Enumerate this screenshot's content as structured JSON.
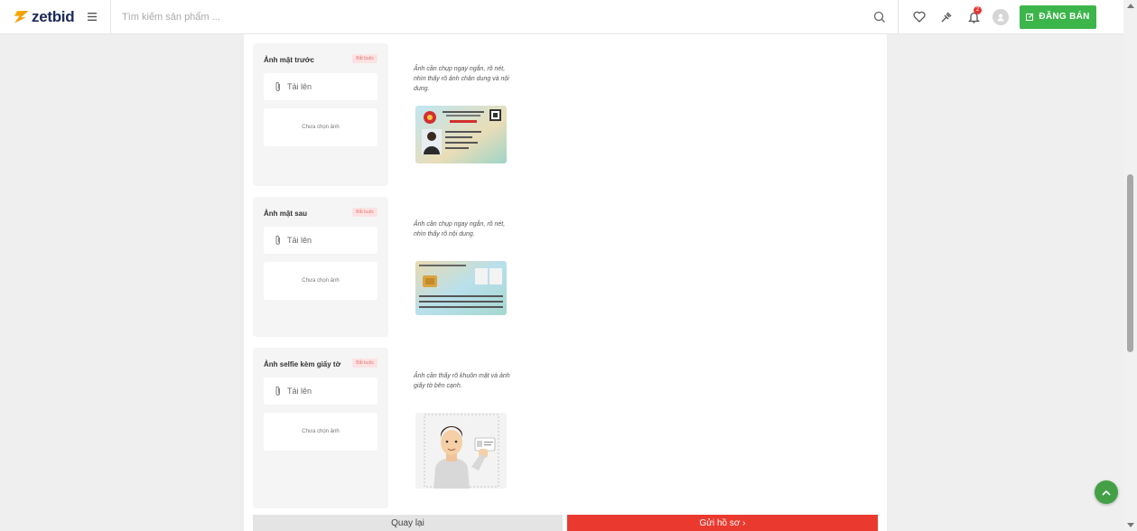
{
  "header": {
    "logo_text": "zetbid",
    "search_placeholder": "Tìm kiếm sản phẩm ...",
    "notification_count": "2",
    "sell_button_label": "ĐĂNG BÁN"
  },
  "cards": [
    {
      "title": "Ảnh mặt trước",
      "badge": "Bắt buộc",
      "upload_label": "Tải lên",
      "preview_text": "Chưa chọn ảnh",
      "hint": "Ảnh cần chụp ngay ngắn, rõ nét, nhìn thấy rõ ảnh chân dung và nội dung."
    },
    {
      "title": "Ảnh mặt sau",
      "badge": "Bắt buộc",
      "upload_label": "Tải lên",
      "preview_text": "Chưa chọn ảnh",
      "hint": "Ảnh cần chụp ngay ngắn, rõ nét, nhìn thấy rõ nội dung."
    },
    {
      "title": "Ảnh selfie kèm giấy tờ",
      "badge": "Bắt buộc",
      "upload_label": "Tải lên",
      "preview_text": "Chưa chọn ảnh",
      "hint": "Ảnh cần thấy rõ khuôn mặt và ảnh giấy tờ bên cạnh."
    }
  ],
  "actions": {
    "back_label": "Quay lại",
    "submit_label": "Gửi hồ sơ  ›"
  },
  "colors": {
    "brand_green": "#3cb54a",
    "submit_red": "#ea3a2f",
    "badge_red": "#e57373"
  }
}
